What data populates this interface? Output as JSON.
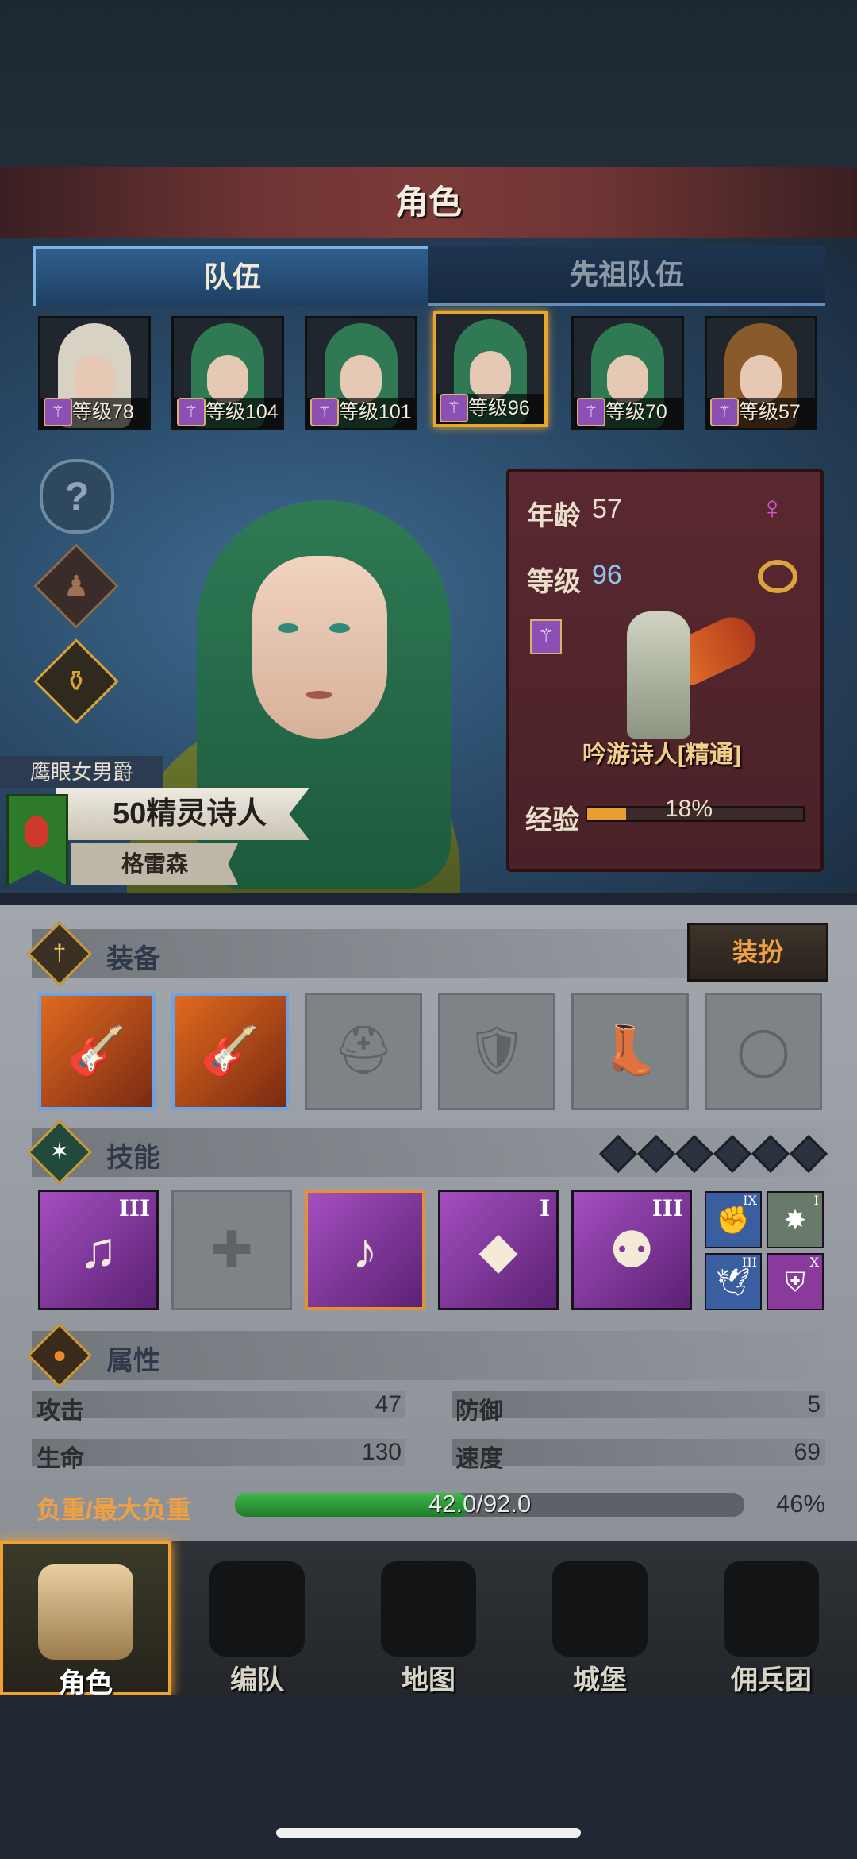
{
  "header": {
    "title": "角色"
  },
  "tabs": [
    {
      "label": "队伍",
      "active": true
    },
    {
      "label": "先祖队伍",
      "active": false
    }
  ],
  "party": [
    {
      "level_label": "等级78",
      "hair": "#d8d2c4",
      "selected": false
    },
    {
      "level_label": "等级104",
      "hair": "#2f7a55",
      "selected": false
    },
    {
      "level_label": "等级101",
      "hair": "#2f7a55",
      "selected": false
    },
    {
      "level_label": "等级96",
      "hair": "#2f7a55",
      "selected": true
    },
    {
      "level_label": "等级70",
      "hair": "#2f7a55",
      "selected": false
    },
    {
      "level_label": "等级57",
      "hair": "#8a5a2a",
      "selected": false
    }
  ],
  "side_buttons": [
    {
      "name": "help-icon",
      "glyph": "?"
    },
    {
      "name": "character-figure-icon",
      "glyph": "♟"
    },
    {
      "name": "potion-bag-icon",
      "glyph": "⚱"
    }
  ],
  "character": {
    "title": "鹰眼女男爵",
    "name": "50精灵诗人",
    "house": "格雷森"
  },
  "info": {
    "age_label": "年龄",
    "age": "57",
    "level_label": "等级",
    "level": "96",
    "class_name": "吟游诗人[精通]",
    "exp_label": "经验",
    "exp_percent": "18%",
    "exp_fraction": 0.18,
    "gender_icon": "female-icon",
    "gender_glyph": "♀"
  },
  "equipment": {
    "title": "装备",
    "dress_button": "装扮",
    "slots": [
      {
        "name": "guitar-weapon-slot",
        "glyph": "🎸",
        "filled": true
      },
      {
        "name": "guitar-offhand-slot",
        "glyph": "🎸",
        "filled": true
      },
      {
        "name": "helmet-slot",
        "glyph": "⛑",
        "filled": false
      },
      {
        "name": "armor-slot",
        "glyph": "🛡",
        "filled": false
      },
      {
        "name": "boots-slot",
        "glyph": "👢",
        "filled": false
      },
      {
        "name": "ring-slot",
        "glyph": "◯",
        "filled": false
      }
    ]
  },
  "skills": {
    "title": "技能",
    "items": [
      {
        "name": "music-note-skill",
        "glyph": "♫",
        "rank": "III",
        "empty": false,
        "selected": false
      },
      {
        "name": "empty-skill-slot",
        "glyph": "✚",
        "rank": "",
        "empty": true,
        "selected": false
      },
      {
        "name": "crystal-note-skill",
        "glyph": "♪",
        "rank": "",
        "empty": false,
        "selected": true
      },
      {
        "name": "crystal-hand-skill",
        "glyph": "◆",
        "rank": "I",
        "empty": false,
        "selected": false
      },
      {
        "name": "group-crystal-skill",
        "glyph": "⚉",
        "rank": "III",
        "empty": false,
        "selected": false
      }
    ],
    "mini": [
      {
        "name": "fist-burst-skill",
        "glyph": "✊",
        "rank": "IX",
        "color": "#3a5fa0"
      },
      {
        "name": "explosion-skill",
        "glyph": "✸",
        "rank": "I",
        "color": "#6a7a6a"
      },
      {
        "name": "bird-skill",
        "glyph": "🕊",
        "rank": "III",
        "color": "#3a5fa0"
      },
      {
        "name": "shield-skill",
        "glyph": "⛨",
        "rank": "X",
        "color": "#8a3a9a"
      }
    ]
  },
  "attributes": {
    "title": "属性",
    "stats": [
      {
        "label": "攻击",
        "value": "47"
      },
      {
        "label": "防御",
        "value": "5"
      },
      {
        "label": "生命",
        "value": "130"
      },
      {
        "label": "速度",
        "value": "69"
      }
    ],
    "load_label": "负重/最大负重",
    "load_value": "42.0/92.0",
    "load_percent": "46%",
    "load_fraction": 0.46
  },
  "nav": [
    {
      "label": "角色",
      "active": true
    },
    {
      "label": "编队",
      "active": false
    },
    {
      "label": "地图",
      "active": false
    },
    {
      "label": "城堡",
      "active": false
    },
    {
      "label": "佣兵团",
      "active": false
    }
  ]
}
